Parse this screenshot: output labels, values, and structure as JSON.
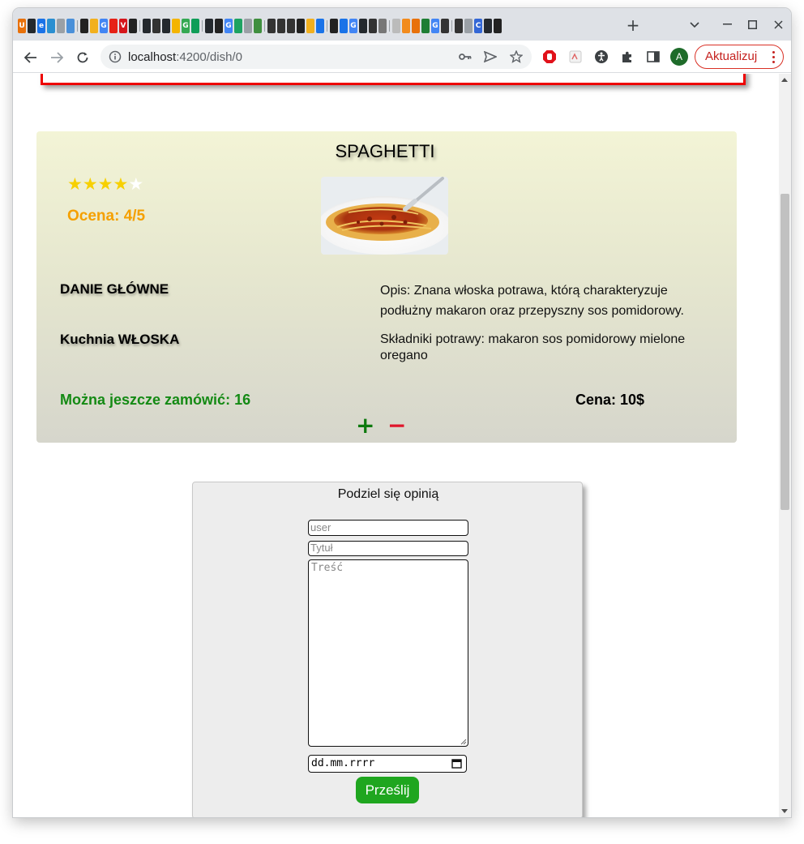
{
  "browser": {
    "tab_favicons": [
      {
        "icon": "u-icon",
        "color": "#e8710a",
        "glyph": "U"
      },
      {
        "icon": "github-icon",
        "color": "#24292e",
        "glyph": ""
      },
      {
        "icon": "edge-icon",
        "color": "#1a73e8",
        "glyph": "e"
      },
      {
        "icon": "edge-icon",
        "color": "#2a8fd1",
        "glyph": ""
      },
      {
        "icon": "docs-icon",
        "color": "#9aa0a6",
        "glyph": ""
      },
      {
        "icon": "person-icon",
        "color": "#4a90d9",
        "glyph": ""
      },
      {
        "icon": "bars-icon",
        "color": "#222222",
        "glyph": ""
      },
      {
        "icon": "arrows-icon",
        "color": "#f2b01e",
        "glyph": ""
      },
      {
        "icon": "google-icon",
        "color": "#4285f4",
        "glyph": "G"
      },
      {
        "icon": "youtube-icon",
        "color": "#e62117",
        "glyph": ""
      },
      {
        "icon": "v-icon",
        "color": "#d5161c",
        "glyph": "V"
      },
      {
        "icon": "bars-icon",
        "color": "#222222",
        "glyph": ""
      },
      {
        "icon": "github-icon",
        "color": "#24292e",
        "glyph": ""
      },
      {
        "icon": "headphones-icon",
        "color": "#333333",
        "glyph": ""
      },
      {
        "icon": "github-icon",
        "color": "#24292e",
        "glyph": ""
      },
      {
        "icon": "folder-icon",
        "color": "#f4b400",
        "glyph": ""
      },
      {
        "icon": "google-icon",
        "color": "#34a853",
        "glyph": "G"
      },
      {
        "icon": "chrome-icon",
        "color": "#0f9d58",
        "glyph": ""
      },
      {
        "icon": "github-icon",
        "color": "#24292e",
        "glyph": ""
      },
      {
        "icon": "bars-icon",
        "color": "#222222",
        "glyph": ""
      },
      {
        "icon": "google-icon",
        "color": "#4285f4",
        "glyph": "G"
      },
      {
        "icon": "stack-icon",
        "color": "#1ea362",
        "glyph": ""
      },
      {
        "icon": "search-icon",
        "color": "#9aa0a6",
        "glyph": ""
      },
      {
        "icon": "globe-icon",
        "color": "#3f8f3f",
        "glyph": ""
      },
      {
        "icon": "headphones-icon",
        "color": "#333333",
        "glyph": ""
      },
      {
        "icon": "headphones-icon",
        "color": "#333333",
        "glyph": ""
      },
      {
        "icon": "headphones-icon",
        "color": "#333333",
        "glyph": ""
      },
      {
        "icon": "camera-icon",
        "color": "#222222",
        "glyph": ""
      },
      {
        "icon": "arrows-icon",
        "color": "#f2b01e",
        "glyph": ""
      },
      {
        "icon": "list-icon",
        "color": "#1a73e8",
        "glyph": ""
      },
      {
        "icon": "bars-icon",
        "color": "#222222",
        "glyph": ""
      },
      {
        "icon": "list-icon",
        "color": "#1a73e8",
        "glyph": ""
      },
      {
        "icon": "google-icon",
        "color": "#4285f4",
        "glyph": "G"
      },
      {
        "icon": "github-icon",
        "color": "#24292e",
        "glyph": ""
      },
      {
        "icon": "headphones-icon",
        "color": "#333333",
        "glyph": ""
      },
      {
        "icon": "grid-icon",
        "color": "#777777",
        "glyph": ""
      },
      {
        "icon": "dot-icon",
        "color": "#bbbbbb",
        "glyph": ""
      },
      {
        "icon": "orange-square-icon",
        "color": "#f28b1d",
        "glyph": ""
      },
      {
        "icon": "orange-square-icon",
        "color": "#e8710a",
        "glyph": ""
      },
      {
        "icon": "green-circle-icon",
        "color": "#1e7e34",
        "glyph": ""
      },
      {
        "icon": "google-icon",
        "color": "#4285f4",
        "glyph": "G"
      },
      {
        "icon": "headphones-icon",
        "color": "#333333",
        "glyph": ""
      },
      {
        "icon": "headphones-icon",
        "color": "#333333",
        "glyph": ""
      },
      {
        "icon": "search-icon",
        "color": "#9aa0a6",
        "glyph": ""
      },
      {
        "icon": "blue-c-icon",
        "color": "#3367d6",
        "glyph": "C"
      },
      {
        "icon": "github-icon",
        "color": "#24292e",
        "glyph": ""
      },
      {
        "icon": "bars-icon",
        "color": "#222222",
        "glyph": ""
      }
    ],
    "url_host": "localhost",
    "url_path": ":4200/dish/0",
    "update_label": "Aktualizuj",
    "profile_initial": "A",
    "colors": {
      "update_red": "#c5221f",
      "profile_green": "#1e6b2a"
    }
  },
  "dish": {
    "name": "SPAGHETTI",
    "rating": 4,
    "max_rating": 5,
    "rating_text": "Ocena: 4/5",
    "photo_alt": "spaghetti-photo",
    "category": "DANIE GŁÓWNE",
    "cuisine_prefix": "Kuchnia ",
    "cuisine": "WŁOSKA",
    "description": "Opis: Znana włoska potrawa, którą charakteryzuje podłużny makaron oraz przepyszny sos pomidorowy.",
    "ingredients_prefix": "Składniki potrawy: ",
    "ingredients": "makaron sos pomidorowy mielone oregano",
    "available_prefix": "Można jeszcze zamówić: ",
    "available_count": "16",
    "price_prefix": "Cena: ",
    "price": "10$",
    "plus_label": "+",
    "minus_label": "−",
    "colors": {
      "stars": "#f7d000",
      "rating": "#f5a000",
      "available": "#148a14",
      "minus": "#e0162b",
      "plus": "#0e7a0e"
    }
  },
  "review_form": {
    "title": "Podziel się opinią",
    "user_placeholder": "user",
    "title_placeholder": "Tytuł",
    "body_placeholder": "Treść",
    "date_placeholder": "dd.mm.rrrr",
    "submit_label": "Prześlij",
    "colors": {
      "submit": "#1fa61f"
    }
  }
}
